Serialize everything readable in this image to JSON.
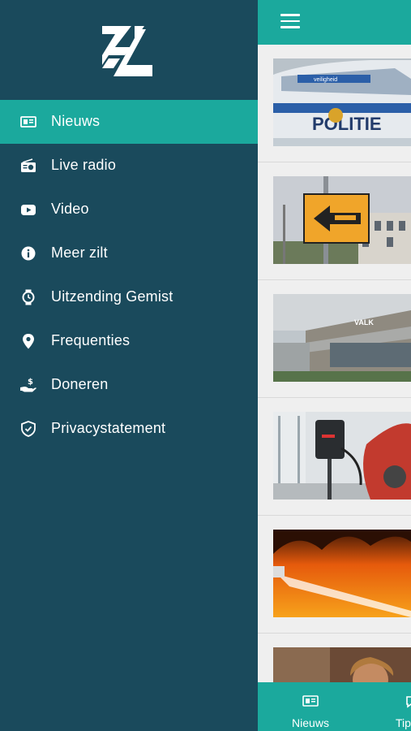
{
  "drawer": {
    "logo_alt": "ZL",
    "items": [
      {
        "label": "Nieuws",
        "icon": "newspaper-icon",
        "active": true
      },
      {
        "label": "Live radio",
        "icon": "radio-icon",
        "active": false
      },
      {
        "label": "Video",
        "icon": "youtube-icon",
        "active": false
      },
      {
        "label": "Meer zilt",
        "icon": "info-icon",
        "active": false
      },
      {
        "label": "Uitzending Gemist",
        "icon": "watch-icon",
        "active": false
      },
      {
        "label": "Frequenties",
        "icon": "location-pin-icon",
        "active": false
      },
      {
        "label": "Doneren",
        "icon": "donate-hand-icon",
        "active": false
      },
      {
        "label": "Privacystatement",
        "icon": "shield-check-icon",
        "active": false
      }
    ]
  },
  "app": {
    "bottom_tabs": [
      {
        "label": "Nieuws",
        "icon": "newspaper-icon"
      },
      {
        "label": "Tip",
        "icon": "chat-icon"
      }
    ]
  },
  "colors": {
    "drawer_bg": "#1a4a5c",
    "accent": "#1ba99d",
    "text": "#ffffff"
  }
}
